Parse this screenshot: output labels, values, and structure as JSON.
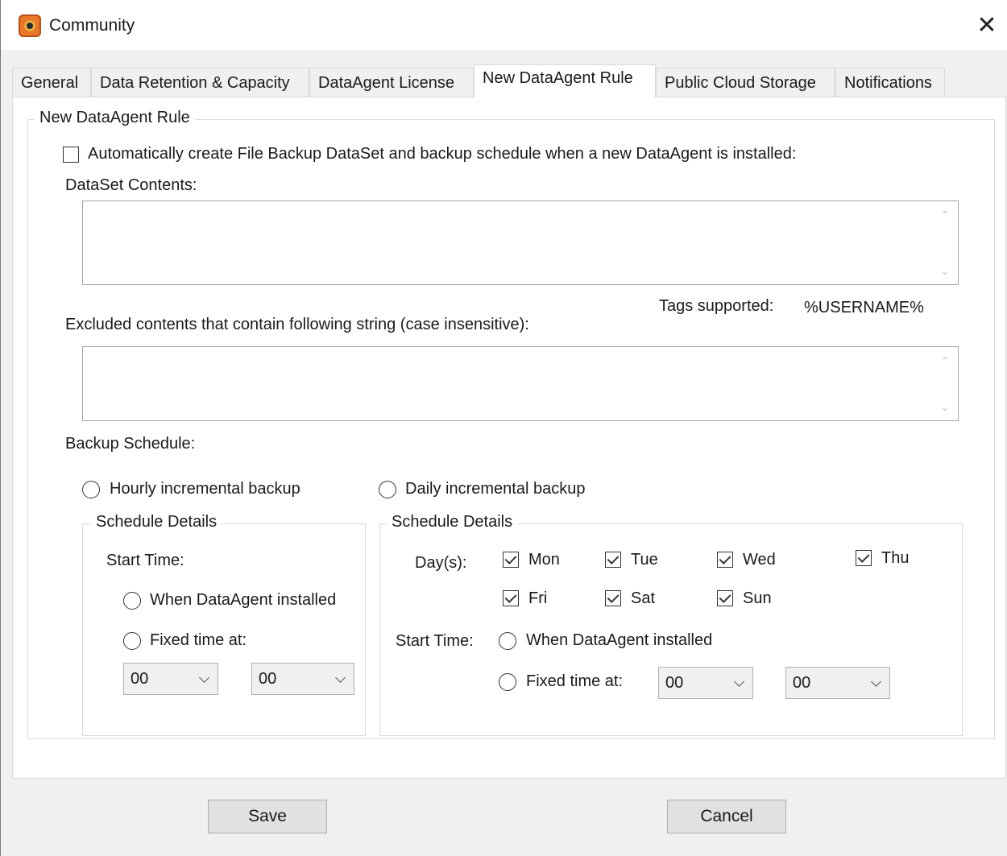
{
  "window": {
    "title": "Community",
    "close_glyph": "✕"
  },
  "tabs": [
    {
      "label": "General"
    },
    {
      "label": "Data Retention & Capacity"
    },
    {
      "label": "DataAgent License"
    },
    {
      "label": "New DataAgent Rule"
    },
    {
      "label": "Public Cloud Storage"
    },
    {
      "label": "Notifications"
    }
  ],
  "active_tab": "New DataAgent Rule",
  "rule": {
    "group_title": "New DataAgent Rule",
    "auto_create_label": "Automatically create File Backup DataSet and backup schedule when a new DataAgent is installed:",
    "auto_create_checked": false,
    "dataset_contents_label": "DataSet Contents:",
    "dataset_contents_value": "",
    "tags_label": "Tags supported:",
    "tags_value": "%USERNAME%",
    "excluded_label": "Excluded contents that contain following string (case insensitive):",
    "excluded_value": ""
  },
  "schedule": {
    "label": "Backup Schedule:",
    "hourly": {
      "radio_label": "Hourly incremental backup",
      "details_title": "Schedule Details",
      "start_time_label": "Start Time:",
      "when_installed_label": "When DataAgent installed",
      "fixed_time_label": "Fixed time at:",
      "hour": "00",
      "minute": "00"
    },
    "daily": {
      "radio_label": "Daily incremental backup",
      "details_title": "Schedule Details",
      "days_label": "Day(s):",
      "days": [
        {
          "label": "Mon",
          "checked": true
        },
        {
          "label": "Tue",
          "checked": true
        },
        {
          "label": "Wed",
          "checked": true
        },
        {
          "label": "Thu",
          "checked": true
        },
        {
          "label": "Fri",
          "checked": true
        },
        {
          "label": "Sat",
          "checked": true
        },
        {
          "label": "Sun",
          "checked": true
        }
      ],
      "start_time_label": "Start Time:",
      "when_installed_label": "When DataAgent installed",
      "fixed_time_label": "Fixed time at:",
      "hour": "00",
      "minute": "00"
    }
  },
  "buttons": {
    "save": "Save",
    "cancel": "Cancel"
  },
  "icons": {
    "app": "app-logo-icon",
    "close": "close-icon",
    "scroll_up": "chevron-up-icon",
    "scroll_down": "chevron-down-icon"
  }
}
